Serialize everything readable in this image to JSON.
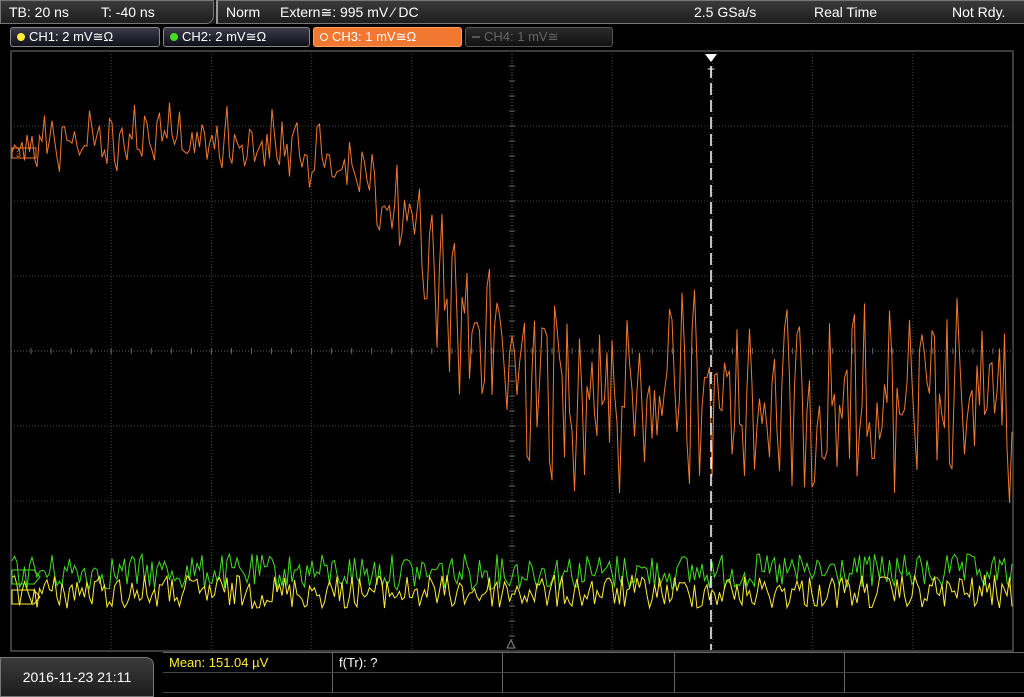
{
  "timebase": {
    "tb": "TB: 20 ns",
    "trigger_time": "T: -40 ns"
  },
  "status": {
    "mode": "Norm",
    "trigger_source": "Extern≅: 995 mV ⁄ DC",
    "sample_rate": "2.5 GSa/s",
    "acquisition": "Real Time",
    "state": "Not Rdy."
  },
  "channels": [
    {
      "label": "CH1: 2 mV≅Ω",
      "color": "#ffee33",
      "state": "on"
    },
    {
      "label": "CH2: 2 mV≅Ω",
      "color": "#44dd22",
      "state": "on"
    },
    {
      "label": "CH3: 1 mV≅Ω",
      "color": "#f07830",
      "state": "active"
    },
    {
      "label": "CH4: 1 mV≅",
      "color": "#666666",
      "state": "off"
    }
  ],
  "markers": {
    "ch3": "3",
    "trigger": "T"
  },
  "datetime": "2016-11-23 21:11",
  "measurements": {
    "mean": "Mean: 151.04 µV",
    "rise": "f(Tr): ?"
  },
  "colors": {
    "grid": "#555555",
    "ch1": "#ffee33",
    "ch2": "#44dd22",
    "ch3": "#f07830",
    "trigger_line": "#ffffff"
  }
}
